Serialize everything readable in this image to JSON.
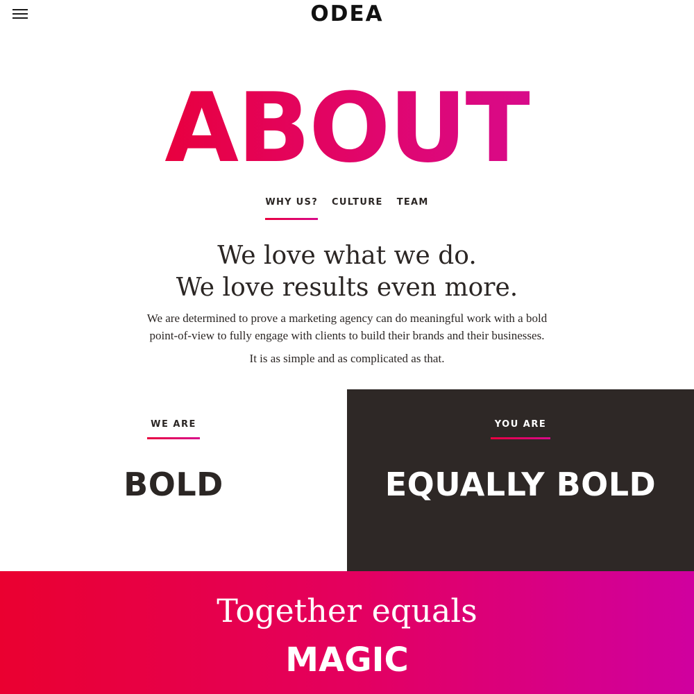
{
  "header": {
    "menu_icon": "hamburger-menu-icon",
    "logo": "ODEA"
  },
  "hero": {
    "title": "ABOUT"
  },
  "tabs": [
    {
      "label": "WHY US?",
      "active": true
    },
    {
      "label": "CULTURE",
      "active": false
    },
    {
      "label": "TEAM",
      "active": false
    }
  ],
  "intro": {
    "headline_line1": "We love what we do.",
    "headline_line2": "We love results even more.",
    "body_line1": "We are determined to prove a marketing agency can do meaningful work with a bold",
    "body_line2": "point-of-view to fully engage with clients to build their brands and their businesses.",
    "body2": "It is as simple and as complicated as that."
  },
  "panels": {
    "left": {
      "label": "WE ARE",
      "word": "BOLD"
    },
    "right": {
      "label": "YOU ARE",
      "word": "EQUALLY BOLD"
    }
  },
  "magic": {
    "line1": "Together equals",
    "line2": "MAGIC"
  },
  "colors": {
    "accent_start": "#e8003f",
    "accent_end": "#d80a8a",
    "dark_panel": "#2e2826",
    "text": "#2b2624"
  }
}
